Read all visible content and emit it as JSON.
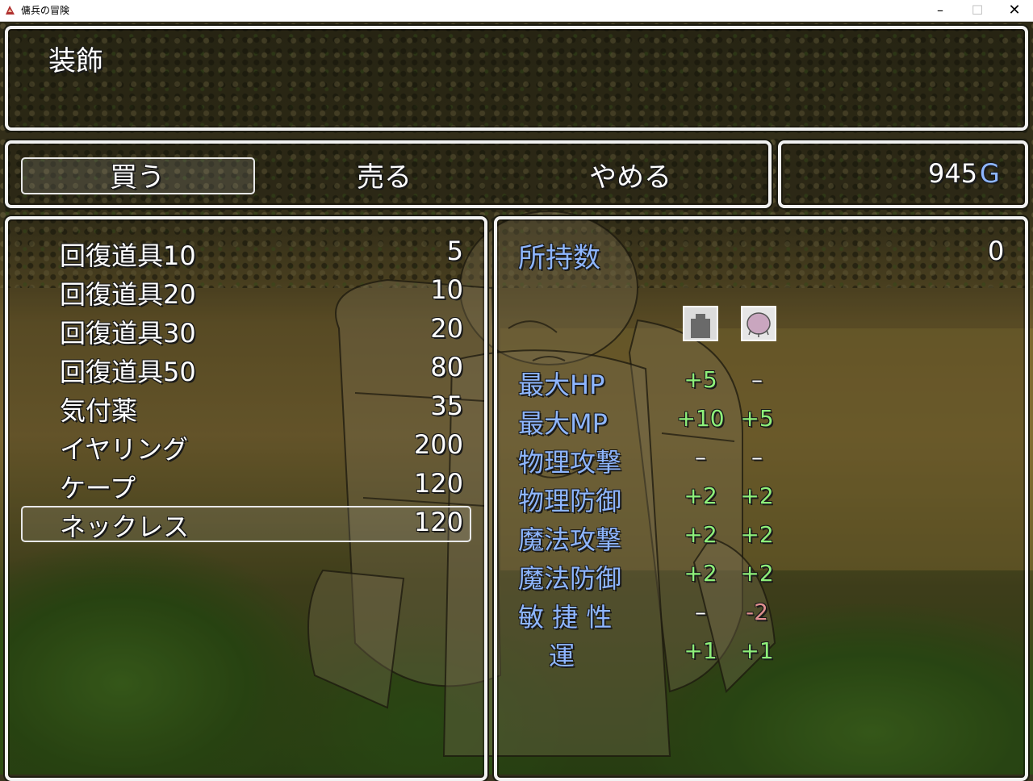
{
  "window": {
    "title": "傭兵の冒険",
    "min_glyph": "–",
    "max_glyph": "☐",
    "close_glyph": "✕"
  },
  "help": {
    "text": "装飾"
  },
  "commands": [
    {
      "label": "買う",
      "selected": true
    },
    {
      "label": "売る",
      "selected": false
    },
    {
      "label": "やめる",
      "selected": false
    }
  ],
  "gold": {
    "amount": "945",
    "unit": "G"
  },
  "items": [
    {
      "name": "回復道具10",
      "price": "5"
    },
    {
      "name": "回復道具20",
      "price": "10"
    },
    {
      "name": "回復道具30",
      "price": "20"
    },
    {
      "name": "回復道具50",
      "price": "80"
    },
    {
      "name": "気付薬",
      "price": "35"
    },
    {
      "name": "イヤリング",
      "price": "200"
    },
    {
      "name": "ケープ",
      "price": "120"
    },
    {
      "name": "ネックレス",
      "price": "120"
    }
  ],
  "selected_item_index": 7,
  "status": {
    "possession_label": "所持数",
    "possession_value": "0",
    "actors": [
      {
        "icon": "knight-silhouette-icon"
      },
      {
        "icon": "pink-blob-icon"
      }
    ],
    "params": [
      {
        "label": "最大HP",
        "a": "+5",
        "b": "–"
      },
      {
        "label": "最大MP",
        "a": "+10",
        "b": "+5"
      },
      {
        "label": "物理攻撃",
        "a": "–",
        "b": "–"
      },
      {
        "label": "物理防御",
        "a": "+2",
        "b": "+2"
      },
      {
        "label": "魔法攻撃",
        "a": "+2",
        "b": "+2"
      },
      {
        "label": "魔法防御",
        "a": "+2",
        "b": "+2"
      },
      {
        "label": "敏 捷 性",
        "a": "–",
        "b": "-2"
      },
      {
        "label": "運",
        "a": "+1",
        "b": "+1"
      }
    ]
  },
  "colors": {
    "system_blue": "#8eb6ff",
    "power_up": "#8ef07a",
    "power_down": "#e09090",
    "window_border": "#f2f2f2"
  }
}
